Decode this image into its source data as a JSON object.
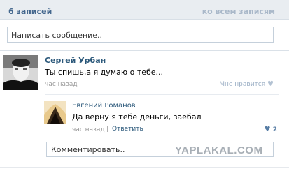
{
  "wall": {
    "count_label": "6 записей",
    "all_posts_link": "ко всем записям",
    "post_placeholder": "Написать сообщение.."
  },
  "post": {
    "author": "Сергей Урбан",
    "text": "Ты спишь,а я думаю о тебе...",
    "date": "час назад",
    "like_label": "Мне нравится",
    "like_icon": "heart-icon"
  },
  "reply": {
    "author": "Евгений Романов",
    "text": "Да верну я тебе деньги, заебал",
    "date": "час назад",
    "separator": "|",
    "reply_link": "Ответить",
    "likes": "2",
    "like_icon": "heart-icon"
  },
  "comment": {
    "placeholder": "Комментировать.."
  },
  "watermark": "YAPLAKAL.COM",
  "colors": {
    "header_bg": "#e9edf1",
    "link": "#2b587a",
    "muted_link": "#a9b8c9",
    "like_active": "#567ca4"
  }
}
